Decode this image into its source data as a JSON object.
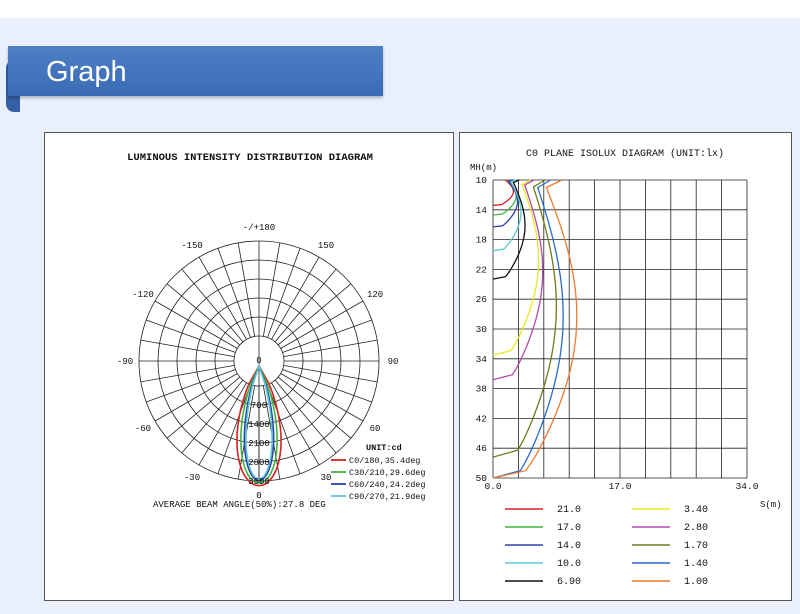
{
  "header": {
    "title": "Graph"
  },
  "chart_data": [
    {
      "type": "polar",
      "title": "LUMINOUS INTENSITY DISTRIBUTION DIAGRAM",
      "angle_labels": [
        {
          "deg": 180,
          "label": "-/+180"
        },
        {
          "deg": -150,
          "label": "-150"
        },
        {
          "deg": 150,
          "label": "150"
        },
        {
          "deg": -120,
          "label": "-120"
        },
        {
          "deg": 120,
          "label": "120"
        },
        {
          "deg": -90,
          "label": "-90"
        },
        {
          "deg": 90,
          "label": "90"
        },
        {
          "deg": -60,
          "label": "-60"
        },
        {
          "deg": 60,
          "label": "60"
        },
        {
          "deg": -30,
          "label": "-30"
        },
        {
          "deg": 30,
          "label": "30"
        },
        {
          "deg": 0,
          "label": "0"
        }
      ],
      "radial_labels": [
        "0",
        "700",
        "1400",
        "2100",
        "2800",
        "3500"
      ],
      "radial_max": 3500,
      "unit": "UNIT:cd",
      "footer": "AVERAGE BEAM ANGLE(50%):27.8 DEG",
      "series": [
        {
          "name": "C0/180,35.4deg",
          "color": "#d92020",
          "peak": 3450,
          "half_angle": 17.7
        },
        {
          "name": "C30/210,29.6deg",
          "color": "#3fb63f",
          "peak": 3350,
          "half_angle": 14.8
        },
        {
          "name": "C60/240,24.2deg",
          "color": "#2a3fa8",
          "peak": 3250,
          "half_angle": 12.1
        },
        {
          "name": "C90/270,21.9deg",
          "color": "#5ec8d8",
          "peak": 3200,
          "half_angle": 10.95
        }
      ]
    },
    {
      "type": "line",
      "title": "C0 PLANE ISOLUX DIAGRAM (UNIT:lx)",
      "ylabel": "MH(m)",
      "xlabel": "S(m)",
      "y_ticks": [
        "10",
        "14",
        "18",
        "22",
        "26",
        "30",
        "34",
        "38",
        "42",
        "46",
        "50"
      ],
      "x_ticks": [
        "0.0",
        "17.0",
        "34.0"
      ],
      "xlim": [
        0,
        34
      ],
      "ylim": [
        10,
        50
      ],
      "legend": [
        {
          "value": "21.0",
          "color": "#d92020"
        },
        {
          "value": "17.0",
          "color": "#3fb63f"
        },
        {
          "value": "14.0",
          "color": "#2a3fa8"
        },
        {
          "value": "10.0",
          "color": "#5ec8d8"
        },
        {
          "value": "6.90",
          "color": "#111111"
        },
        {
          "value": "3.40",
          "color": "#e8e820"
        },
        {
          "value": "2.80",
          "color": "#b04ab0"
        },
        {
          "value": "1.70",
          "color": "#6e7a1e"
        },
        {
          "value": "1.40",
          "color": "#2a6ac8"
        },
        {
          "value": "1.00",
          "color": "#f07a30"
        }
      ],
      "series": [
        {
          "value": "21.0",
          "color": "#d92020",
          "mh": 13.4,
          "reach": 3.0
        },
        {
          "value": "17.0",
          "color": "#3fb63f",
          "mh": 14.7,
          "reach": 3.4
        },
        {
          "value": "14.0",
          "color": "#2a3fa8",
          "mh": 16.3,
          "reach": 3.6
        },
        {
          "value": "10.0",
          "color": "#5ec8d8",
          "mh": 19.5,
          "reach": 4.1
        },
        {
          "value": "6.90",
          "color": "#111111",
          "mh": 23.3,
          "reach": 4.7
        },
        {
          "value": "3.40",
          "color": "#e8e820",
          "mh": 33.5,
          "reach": 6.7
        },
        {
          "value": "2.80",
          "color": "#b04ab0",
          "mh": 36.8,
          "reach": 7.3
        },
        {
          "value": "1.70",
          "color": "#6e7a1e",
          "mh": 47.2,
          "reach": 9.3
        },
        {
          "value": "1.40",
          "color": "#2a6ac8",
          "mh": 50.0,
          "reach": 10.3
        },
        {
          "value": "1.00",
          "color": "#f07a30",
          "mh": 50.0,
          "reach": 12.3
        }
      ]
    }
  ]
}
